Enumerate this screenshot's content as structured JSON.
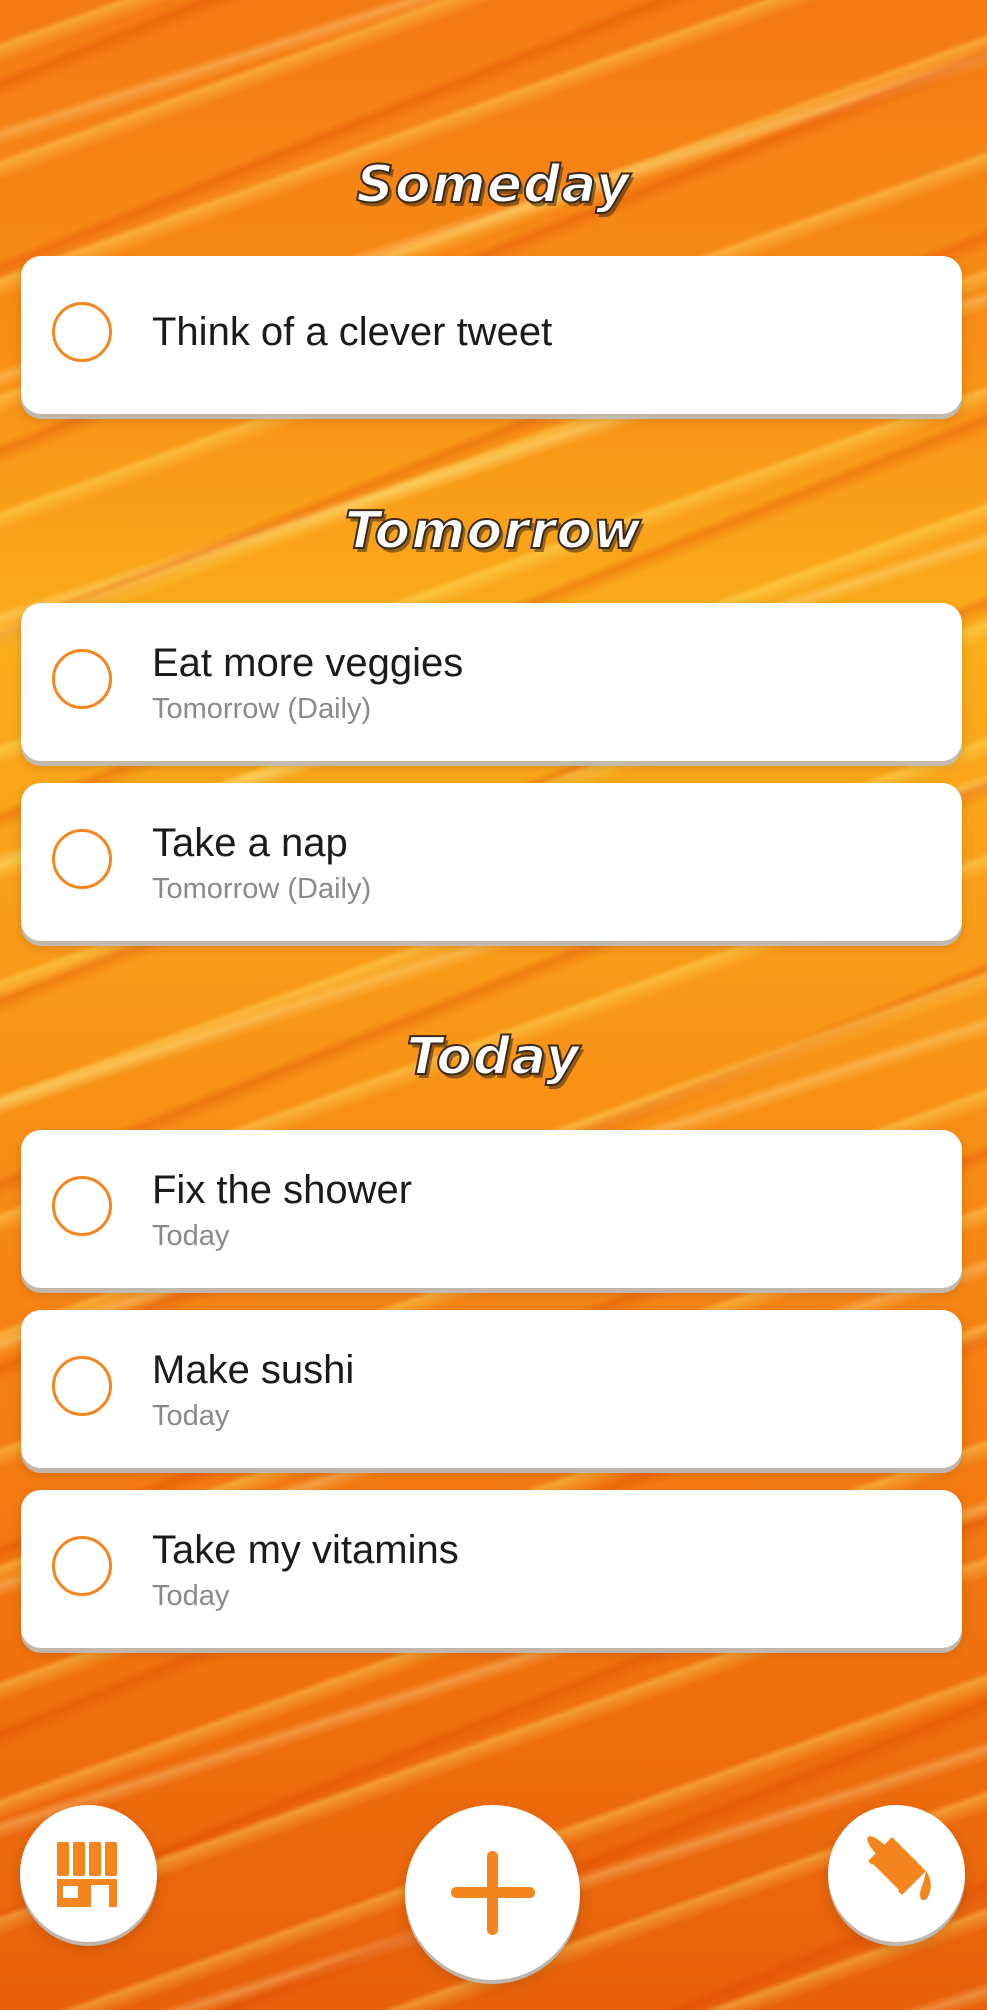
{
  "sections": [
    {
      "title": "Someday",
      "tasks": [
        {
          "title": "Think of a clever tweet",
          "subtitle": ""
        }
      ]
    },
    {
      "title": "Tomorrow",
      "tasks": [
        {
          "title": "Eat more veggies",
          "subtitle": "Tomorrow (Daily)"
        },
        {
          "title": "Take a nap",
          "subtitle": "Tomorrow (Daily)"
        }
      ]
    },
    {
      "title": "Today",
      "tasks": [
        {
          "title": "Fix the shower",
          "subtitle": "Today"
        },
        {
          "title": "Make sushi",
          "subtitle": "Today"
        },
        {
          "title": "Take my vitamins",
          "subtitle": "Today"
        }
      ]
    }
  ],
  "bottom_bar": {
    "left_icon": "store-icon",
    "center_icon": "plus-icon",
    "right_icon": "paint-bucket-icon"
  },
  "colors": {
    "accent": "#f5861f",
    "card_bg": "#ffffff",
    "title_text": "#1b1b1b",
    "subtitle_text": "#8a8a8a"
  }
}
